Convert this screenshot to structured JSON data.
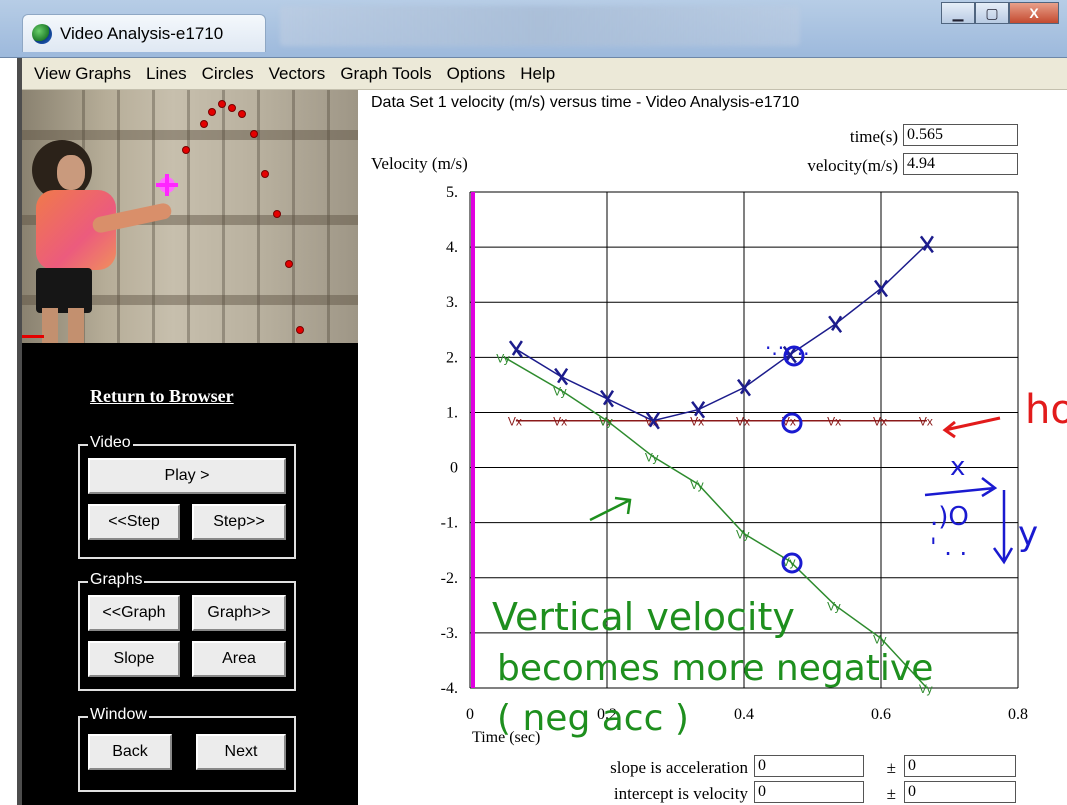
{
  "window": {
    "title": "Video Analysis-e1710",
    "controls": [
      "minimize-icon",
      "maximize-icon",
      "close-icon"
    ],
    "accent": "#9db9dc"
  },
  "menu": [
    "View Graphs",
    "Lines",
    "Circles",
    "Vectors",
    "Graph Tools",
    "Options",
    "Help"
  ],
  "left_panel": {
    "return_link": "Return to Browser",
    "video_group": {
      "label": "Video",
      "play": "Play >",
      "step_back": "<<Step",
      "step_forward": "Step>>"
    },
    "graphs_group": {
      "label": "Graphs",
      "graph_back": "<<Graph",
      "graph_forward": "Graph>>",
      "slope": "Slope",
      "area": "Area"
    },
    "window_group": {
      "label": "Window",
      "back": "Back",
      "next": "Next"
    }
  },
  "graph": {
    "title": "Data Set 1 velocity (m/s) versus time - Video Analysis-e1710",
    "time_label": "time(s)",
    "time_value": "0.565",
    "velocity_label": "velocity(m/s)",
    "velocity_value": "4.94",
    "slope_label": "slope is acceleration",
    "slope_value": "0",
    "intercept_label": "intercept is velocity",
    "intercept_value": "0",
    "pm": "±",
    "pm_value": "0"
  },
  "chart_data": {
    "type": "line",
    "xlabel": "Time (sec)",
    "ylabel": "Velocity (m/s)",
    "xlim": [
      0,
      0.8
    ],
    "ylim": [
      -4,
      5
    ],
    "x_ticks": [
      "0",
      "0.2",
      "0.4",
      "0.6",
      "0.8"
    ],
    "y_ticks": [
      "5.",
      "4.",
      "3.",
      "2.",
      "1.",
      "0",
      "-1.",
      "-2.",
      "-3.",
      "-4."
    ],
    "grid": true,
    "series": [
      {
        "name": "",
        "marker": "Vx",
        "color": "#8b1a1a",
        "x": [
          0.067,
          0.133,
          0.2,
          0.267,
          0.333,
          0.4,
          0.467,
          0.533,
          0.6,
          0.667
        ],
        "y": [
          0.85,
          0.85,
          0.85,
          0.85,
          0.85,
          0.85,
          0.85,
          0.85,
          0.85,
          0.85
        ]
      },
      {
        "name": "",
        "marker": "Vy",
        "color": "#2e8b2e",
        "x": [
          0.05,
          0.133,
          0.2,
          0.267,
          0.333,
          0.4,
          0.467,
          0.533,
          0.6,
          0.667
        ],
        "y": [
          2.0,
          1.4,
          0.85,
          0.2,
          -0.3,
          -1.2,
          -1.7,
          -2.5,
          -3.1,
          -4.0
        ]
      },
      {
        "name": "",
        "marker": "speed",
        "color": "#1c1c8c",
        "x": [
          0.067,
          0.133,
          0.2,
          0.267,
          0.333,
          0.4,
          0.467,
          0.533,
          0.6,
          0.667
        ],
        "y": [
          2.15,
          1.65,
          1.25,
          0.85,
          1.05,
          1.45,
          2.05,
          2.6,
          3.25,
          4.05
        ]
      }
    ],
    "annotations": [
      "Vertical velocity",
      "becomes more negative",
      "( neg acc )",
      "hor",
      "x",
      "y"
    ]
  }
}
